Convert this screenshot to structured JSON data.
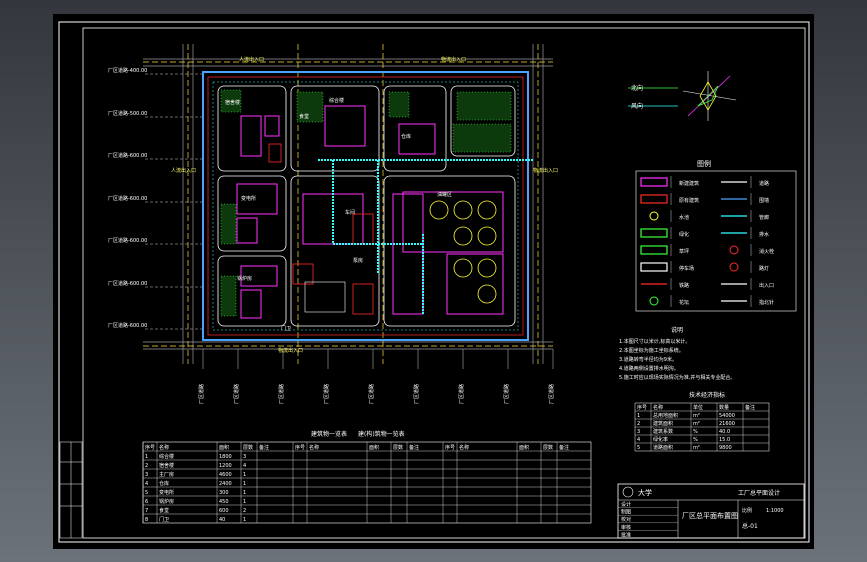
{
  "page": {
    "background_top": "#33373d",
    "background_bottom": "#6c727a",
    "drawing_background": "#000000"
  },
  "colors": {
    "frame": "#ffffff",
    "site_boundary": "#4aa3ff",
    "building": "#ffffff",
    "magenta": "#ff33ff",
    "red": "#ff2a2a",
    "green": "#3cff3c",
    "yellow": "#ffff33",
    "cyan": "#33ffff",
    "road": "#9a9a9a"
  },
  "site_plan": {
    "left_axis_labels": [
      "厂区道路-400.00",
      "厂区道路-500.00",
      "厂区道路-600.00",
      "厂区道路-600.00",
      "厂区道路-600.00",
      "厂区道路-600.00",
      "厂区道路-600.00"
    ],
    "bottom_axis_labels": [
      "厂区道路",
      "厂区道路",
      "厂区道路",
      "厂区道路",
      "厂区道路",
      "厂区道路",
      "厂区道路",
      "厂区道路",
      "厂区道路"
    ],
    "gate_labels": [
      "人流出入口",
      "物流出入口",
      "人流出入口",
      "物流出入口",
      "物流出入口"
    ],
    "building_labels": [
      "宿舍楼",
      "综合楼",
      "车间",
      "仓库",
      "变电所",
      "食堂",
      "门卫",
      "锅炉房",
      "油罐区",
      "泵房"
    ]
  },
  "compass": {
    "labels": [
      "北向",
      "风向"
    ]
  },
  "legend": {
    "title": "图例",
    "items": [
      {
        "label": "新建建筑",
        "icon": "magenta-rect"
      },
      {
        "label": "道路",
        "icon": "double-line"
      },
      {
        "label": "原有建筑",
        "icon": "red-rect"
      },
      {
        "label": "围墙",
        "icon": "blue-line"
      },
      {
        "label": "水池",
        "icon": "yellow-circle"
      },
      {
        "label": "管廊",
        "icon": "cyan-comb"
      },
      {
        "label": "绿化",
        "icon": "green-rect"
      },
      {
        "label": "排水",
        "icon": "cyan-line"
      },
      {
        "label": "草坪",
        "icon": "hatched-rect"
      },
      {
        "label": "消火栓",
        "icon": "hydrant"
      },
      {
        "label": "停车场",
        "icon": "rect"
      },
      {
        "label": "路灯",
        "icon": "red-dot"
      },
      {
        "label": "铁路",
        "icon": "red-line"
      },
      {
        "label": "出入口",
        "icon": "arrow"
      },
      {
        "label": "花坛",
        "icon": "ring"
      },
      {
        "label": "指北针",
        "icon": "tri"
      }
    ]
  },
  "notes": {
    "title": "说明",
    "lines": [
      "1.本图尺寸以米计,标高以米计。",
      "2.本图坐标为施工坐标系统。",
      "3.道路转弯半径均为9米。",
      "4.道路两侧设置排水明沟。",
      "5.施工时应以现场实际情况为准,并与相关专业配合。"
    ]
  },
  "tech_table": {
    "title": "技术经济指标",
    "headers": [
      "序号",
      "名称",
      "单位",
      "数量",
      "备注"
    ],
    "rows": [
      [
        "1",
        "总用地面积",
        "m²",
        "54000",
        ""
      ],
      [
        "2",
        "建筑面积",
        "m²",
        "21600",
        ""
      ],
      [
        "3",
        "建筑系数",
        "%",
        "40.0",
        ""
      ],
      [
        "4",
        "绿化率",
        "%",
        "15.0",
        ""
      ],
      [
        "5",
        "道路面积",
        "m²",
        "9800",
        ""
      ]
    ]
  },
  "bottom_table": {
    "title1": "建筑物一览表",
    "title2": "建(构)筑物一览表",
    "headers": [
      "序号",
      "名称",
      "面积",
      "层数",
      "备注"
    ],
    "rows": [
      [
        "1",
        "综合楼",
        "1800",
        "3",
        ""
      ],
      [
        "2",
        "宿舍楼",
        "1200",
        "4",
        ""
      ],
      [
        "3",
        "主厂房",
        "4600",
        "1",
        ""
      ],
      [
        "4",
        "仓库",
        "2400",
        "1",
        ""
      ],
      [
        "5",
        "变电所",
        "300",
        "1",
        ""
      ],
      [
        "6",
        "锅炉房",
        "450",
        "1",
        ""
      ],
      [
        "7",
        "食堂",
        "600",
        "2",
        ""
      ],
      [
        "8",
        "门卫",
        "40",
        "1",
        ""
      ]
    ]
  },
  "title_block": {
    "school": "大学",
    "drawing_title": "厂区总平面布置图",
    "project": "工厂总平面设计",
    "drawing_no": "总-01",
    "scale_label": "比例",
    "scale": "1:1000",
    "rows": [
      "设计",
      "制图",
      "校对",
      "审核",
      "批准"
    ]
  }
}
